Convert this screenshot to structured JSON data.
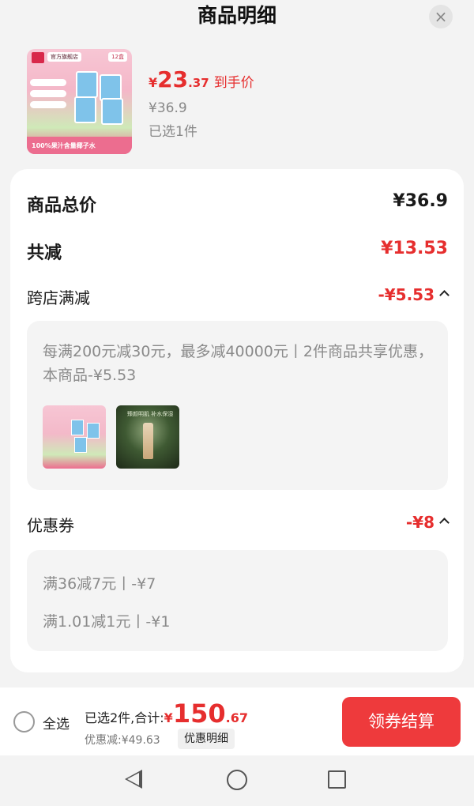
{
  "header": {
    "title": "商品明细",
    "close_icon": "×"
  },
  "product": {
    "thumb_shop": "官方旗舰店",
    "thumb_count": "12盒",
    "thumb_strip": "100%果汁含量椰子水",
    "price_symbol": "¥",
    "price_int": "23",
    "price_dec": ".37",
    "price_label": "到手价",
    "original_price": "¥36.9",
    "selected": "已选1件"
  },
  "summary": {
    "total_label": "商品总价",
    "total_value": "¥36.9",
    "reduce_label": "共减",
    "reduce_value": "¥13.53"
  },
  "cross_store": {
    "label": "跨店满减",
    "value": "-¥5.53",
    "description": "每满200元减30元，最多减40000元丨2件商品共享优惠，本商品-¥5.53",
    "mini2_text": "臻颜明肌 补水保湿"
  },
  "coupon": {
    "label": "优惠券",
    "value": "-¥8",
    "lines": [
      "满36减7元丨-¥7",
      "满1.01减1元丨-¥1"
    ]
  },
  "bottom": {
    "select_all": "全选",
    "summary_text": "已选2件,合计:",
    "total_symbol": "¥",
    "total_int": "150",
    "total_dec": ".67",
    "discount_text": "优惠减:¥49.63",
    "detail_button": "优惠明细",
    "checkout_button": "领券结算"
  },
  "colors": {
    "accent": "#e62e2e",
    "checkout": "#ee3a3c"
  }
}
